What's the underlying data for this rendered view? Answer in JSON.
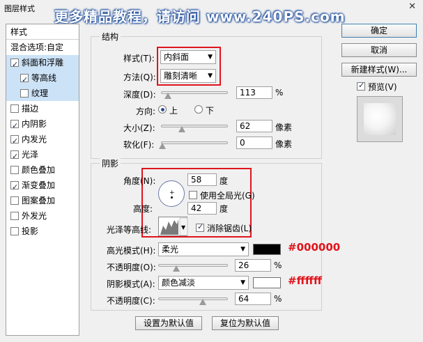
{
  "window": {
    "title": "图层样式",
    "watermark": "更多精品教程，请访问 www.240PS.com"
  },
  "styles_panel": {
    "header": "样式",
    "blend_options": "混合选项:自定",
    "items": [
      {
        "label": "斜面和浮雕",
        "checked": true,
        "selected": true
      },
      {
        "label": "等高线",
        "checked": true,
        "selected": true,
        "sub": true
      },
      {
        "label": "纹理",
        "checked": false,
        "selected": true,
        "sub": true
      },
      {
        "label": "描边",
        "checked": false
      },
      {
        "label": "内阴影",
        "checked": true
      },
      {
        "label": "内发光",
        "checked": true
      },
      {
        "label": "光泽",
        "checked": true
      },
      {
        "label": "颜色叠加",
        "checked": false
      },
      {
        "label": "渐变叠加",
        "checked": true
      },
      {
        "label": "图案叠加",
        "checked": false
      },
      {
        "label": "外发光",
        "checked": false
      },
      {
        "label": "投影",
        "checked": false
      }
    ]
  },
  "structure": {
    "legend": "结构",
    "style_label": "样式(T):",
    "style_value": "内斜面",
    "technique_label": "方法(Q):",
    "technique_value": "雕刻清晰",
    "depth_label": "深度(D):",
    "depth_value": "113",
    "depth_unit": "%",
    "direction_label": "方向:",
    "dir_up": "上",
    "dir_down": "下",
    "size_label": "大小(Z):",
    "size_value": "62",
    "size_unit": "像素",
    "soften_label": "软化(F):",
    "soften_value": "0",
    "soften_unit": "像素"
  },
  "shading": {
    "legend": "阴影",
    "angle_label": "角度(N):",
    "angle_value": "58",
    "angle_unit": "度",
    "global_light_label": "使用全局光(G)",
    "altitude_label": "高度:",
    "altitude_value": "42",
    "altitude_unit": "度",
    "gloss_label": "光泽等高线:",
    "antialias_label": "消除锯齿(L)",
    "highlight_label": "高光模式(H):",
    "highlight_value": "柔光",
    "highlight_opacity_label": "不透明度(O):",
    "highlight_opacity_value": "26",
    "shadow_label": "阴影模式(A):",
    "shadow_value": "颜色减淡",
    "shadow_opacity_label": "不透明度(C):",
    "shadow_opacity_value": "64",
    "percent": "%",
    "highlight_color": "#000000",
    "shadow_color": "#ffffff",
    "highlight_annotation": "#000000",
    "shadow_annotation": "#ffffff"
  },
  "bottom_buttons": {
    "set_default": "设置为默认值",
    "reset_default": "复位为默认值"
  },
  "right_panel": {
    "ok": "确定",
    "cancel": "取消",
    "new_style": "新建样式(W)...",
    "preview": "预览(V)"
  }
}
